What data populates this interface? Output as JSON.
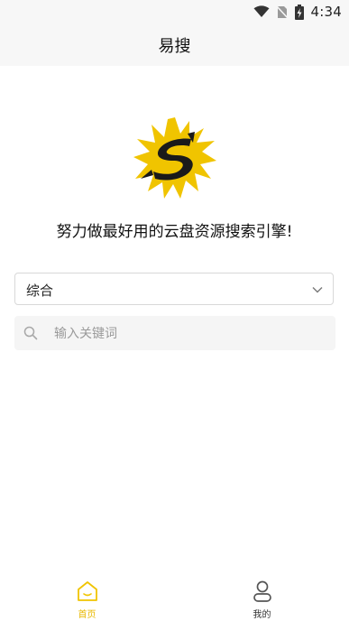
{
  "status_bar": {
    "time": "4:34",
    "icons": [
      "wifi-icon",
      "no-sim-icon",
      "battery-charging-icon"
    ]
  },
  "header": {
    "title": "易搜"
  },
  "main": {
    "slogan": "努力做最好用的云盘资源搜索引擎!",
    "category_select": {
      "value": "综合"
    },
    "search": {
      "placeholder": "输入关键词",
      "value": ""
    }
  },
  "tabbar": {
    "tabs": [
      {
        "label": "首页",
        "icon": "home-icon",
        "active": true
      },
      {
        "label": "我的",
        "icon": "user-icon",
        "active": false
      }
    ]
  },
  "colors": {
    "accent": "#f0c400",
    "inactive": "#555555",
    "header_bg": "#f7f7f7"
  }
}
